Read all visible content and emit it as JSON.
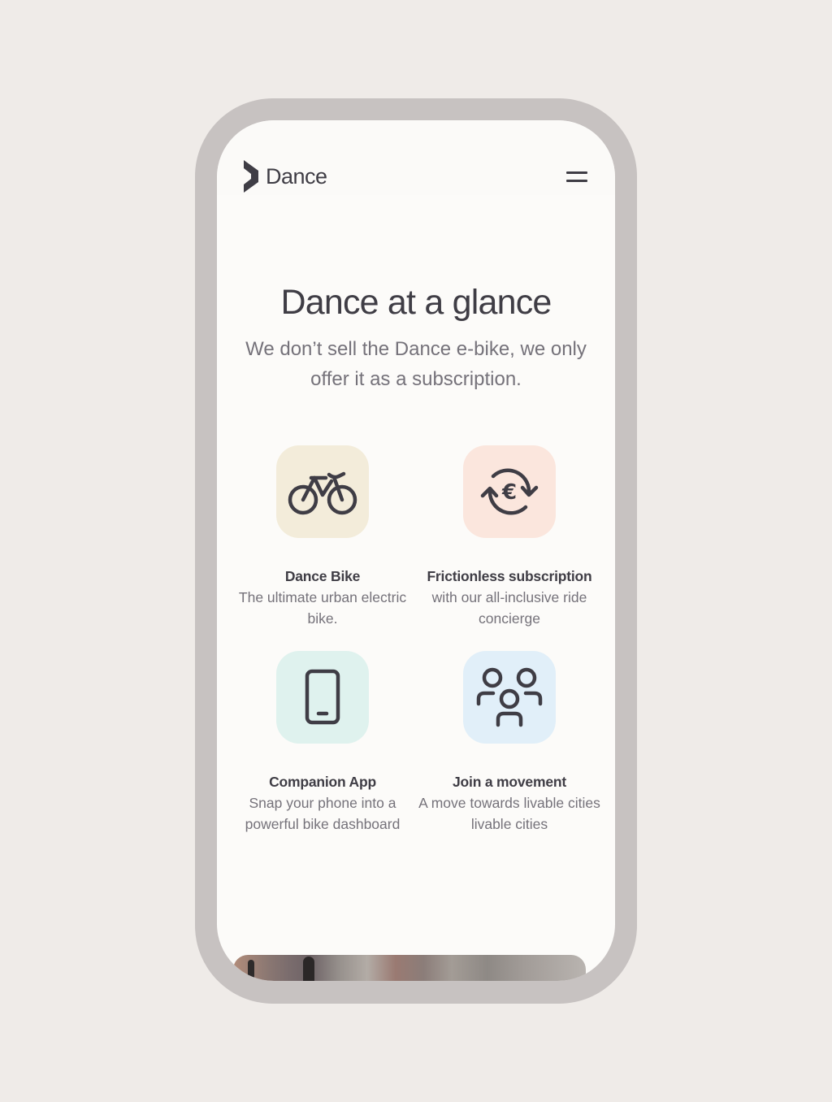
{
  "brand": {
    "name": "Dance"
  },
  "hero": {
    "title": "Dance at a glance",
    "subtitle": "We don’t sell the Dance e-bike, we only offer it as a subscription."
  },
  "features": [
    {
      "icon": "bike-icon",
      "tile_color": "#f3ecda",
      "title": "Dance Bike",
      "description": "The ultimate urban electric bike."
    },
    {
      "icon": "euro-exchange-icon",
      "tile_color": "#fbe6dd",
      "title": "Frictionless subscription",
      "description": "with our all-inclusive ride concierge"
    },
    {
      "icon": "smartphone-icon",
      "tile_color": "#dff2ee",
      "title": "Companion App",
      "description": "Snap your phone into a powerful bike dashboard"
    },
    {
      "icon": "people-group-icon",
      "tile_color": "#e1eff9",
      "title": "Join a movement",
      "description": "A move towards livable cities livable cities"
    }
  ],
  "colors": {
    "page_background": "#efebe8",
    "phone_frame": "#c7c2c1",
    "screen_background": "#fcfbf9",
    "text_primary": "#3f3d45",
    "text_secondary": "#75727a"
  }
}
